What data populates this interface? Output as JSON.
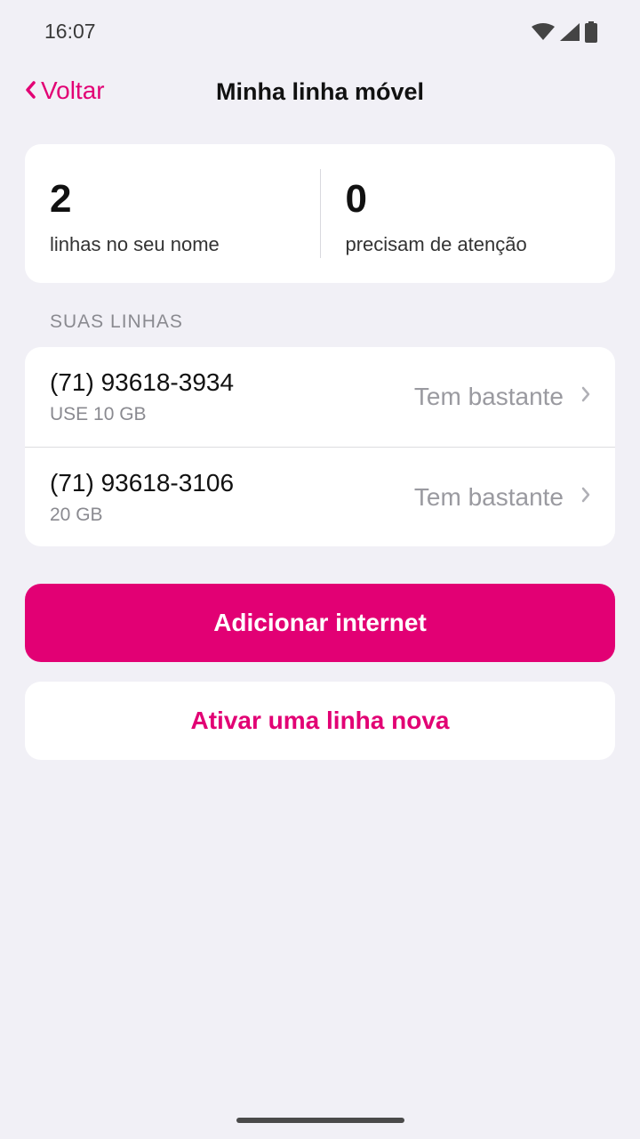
{
  "status_bar": {
    "time": "16:07"
  },
  "nav": {
    "back_label": "Voltar",
    "title": "Minha linha móvel"
  },
  "summary": {
    "lines_count": "2",
    "lines_label": "linhas no seu nome",
    "attention_count": "0",
    "attention_label": "precisam de atenção"
  },
  "section": {
    "label": "SUAS LINHAS"
  },
  "lines": [
    {
      "number": "(71) 93618-3934",
      "plan": "USE 10 GB",
      "status": "Tem bastante"
    },
    {
      "number": "(71) 93618-3106",
      "plan": "20 GB",
      "status": "Tem bastante"
    }
  ],
  "actions": {
    "add_internet": "Adicionar internet",
    "activate_line": "Ativar uma linha nova"
  },
  "colors": {
    "accent": "#e20074",
    "background": "#f1f0f6",
    "card": "#ffffff"
  }
}
